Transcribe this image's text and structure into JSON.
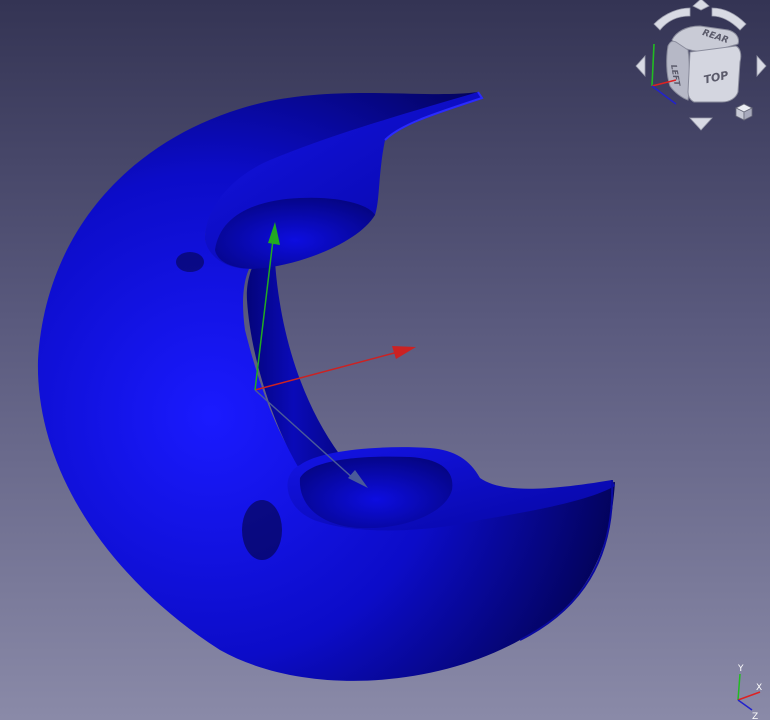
{
  "app": {
    "view": "3d-viewport"
  },
  "navigation_cube": {
    "faces": {
      "top": "TOP",
      "rear": "REAR",
      "left": "LEFT"
    },
    "arrows": [
      "rotate-left",
      "rotate-up",
      "rotate-right",
      "left",
      "right",
      "down"
    ],
    "menu": "view-menu"
  },
  "mini_axis": {
    "x_label": "X",
    "y_label": "Y",
    "z_label": "Z"
  },
  "colors": {
    "background_top": "#343454",
    "background_bottom": "#8a8aa8",
    "model": "#0b0bd0",
    "x_axis": "#cc2222",
    "y_axis": "#22aa22",
    "z_axis": "#4a5a9a"
  }
}
